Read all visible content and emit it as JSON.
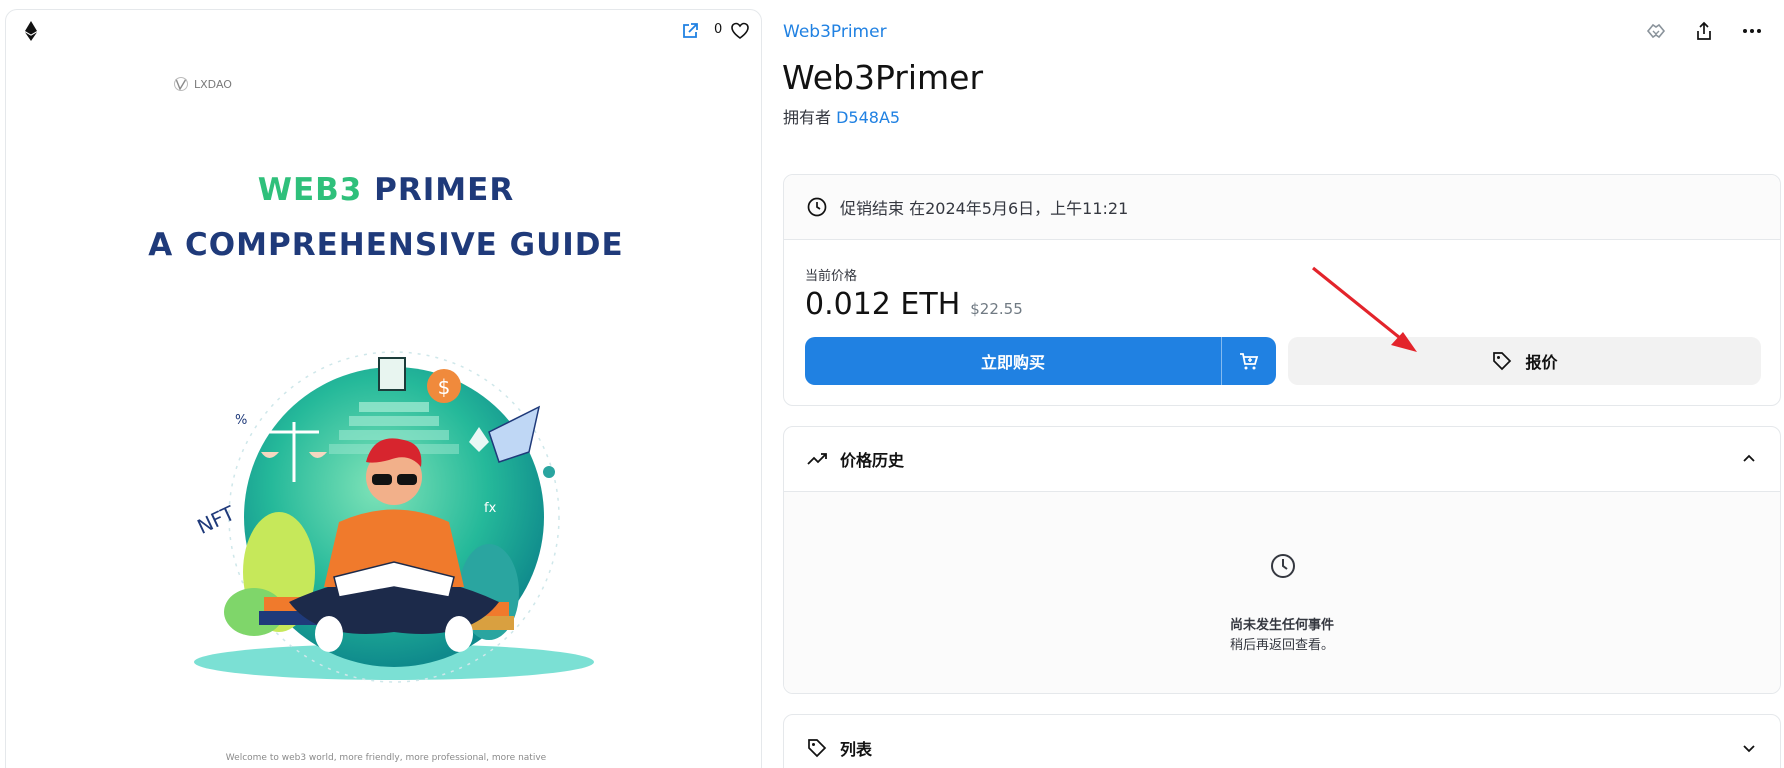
{
  "nft_card": {
    "like_count": "0",
    "artwork": {
      "brand": "LXDAO",
      "title_line1_part1": "WEB3",
      "title_line1_part2": "PRIMER",
      "title_line2": "A COMPREHENSIVE GUIDE",
      "footer": "Welcome to web3 world, more friendly, more professional, more native"
    }
  },
  "header": {
    "collection_name": "Web3Primer",
    "item_title": "Web3Primer",
    "owner_label": "拥有者",
    "owner_name": "D548A5"
  },
  "trade": {
    "sale_end_text": "促销结束 在2024年5月6日，上午11:21",
    "price_label": "当前价格",
    "price_eth": "0.012 ETH",
    "price_usd": "$22.55",
    "buy_now_label": "立即购买",
    "offer_label": "报价"
  },
  "price_history": {
    "title": "价格历史",
    "empty_title": "尚未发生任何事件",
    "empty_subtitle": "稍后再返回查看。"
  },
  "listing": {
    "title": "列表"
  },
  "colors": {
    "accent": "#2081e2",
    "arrow": "#e3242b"
  },
  "icons": [
    "eth-icon",
    "open-external-icon",
    "heart-icon",
    "handshake-icon",
    "share-icon",
    "more-icon",
    "clock-icon",
    "cart-icon",
    "tag-icon",
    "trend-icon",
    "chevron-up-icon",
    "chevron-down-icon"
  ]
}
